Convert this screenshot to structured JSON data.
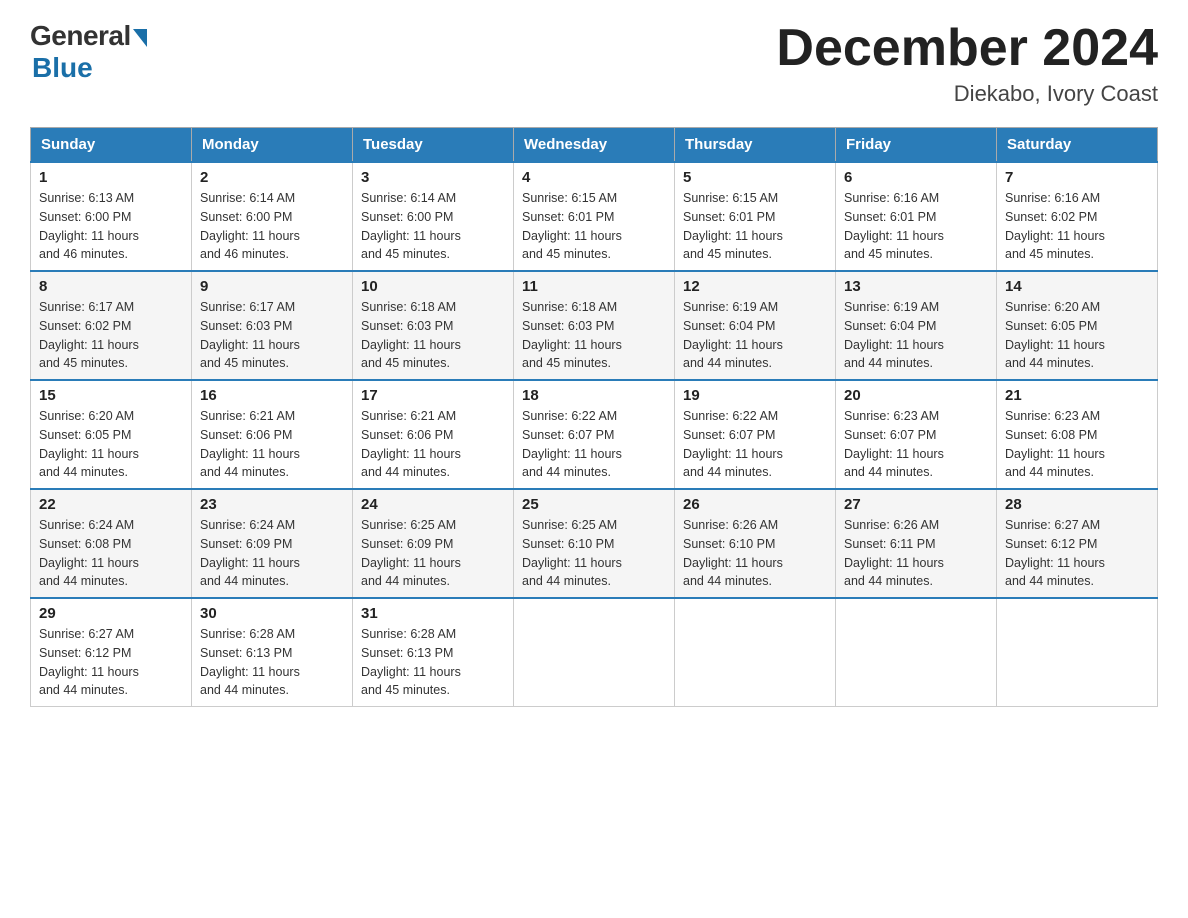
{
  "header": {
    "logo_general": "General",
    "logo_blue": "Blue",
    "month_title": "December 2024",
    "location": "Diekabo, Ivory Coast"
  },
  "weekdays": [
    "Sunday",
    "Monday",
    "Tuesday",
    "Wednesday",
    "Thursday",
    "Friday",
    "Saturday"
  ],
  "weeks": [
    [
      {
        "day": "1",
        "sunrise": "6:13 AM",
        "sunset": "6:00 PM",
        "daylight": "11 hours and 46 minutes."
      },
      {
        "day": "2",
        "sunrise": "6:14 AM",
        "sunset": "6:00 PM",
        "daylight": "11 hours and 46 minutes."
      },
      {
        "day": "3",
        "sunrise": "6:14 AM",
        "sunset": "6:00 PM",
        "daylight": "11 hours and 45 minutes."
      },
      {
        "day": "4",
        "sunrise": "6:15 AM",
        "sunset": "6:01 PM",
        "daylight": "11 hours and 45 minutes."
      },
      {
        "day": "5",
        "sunrise": "6:15 AM",
        "sunset": "6:01 PM",
        "daylight": "11 hours and 45 minutes."
      },
      {
        "day": "6",
        "sunrise": "6:16 AM",
        "sunset": "6:01 PM",
        "daylight": "11 hours and 45 minutes."
      },
      {
        "day": "7",
        "sunrise": "6:16 AM",
        "sunset": "6:02 PM",
        "daylight": "11 hours and 45 minutes."
      }
    ],
    [
      {
        "day": "8",
        "sunrise": "6:17 AM",
        "sunset": "6:02 PM",
        "daylight": "11 hours and 45 minutes."
      },
      {
        "day": "9",
        "sunrise": "6:17 AM",
        "sunset": "6:03 PM",
        "daylight": "11 hours and 45 minutes."
      },
      {
        "day": "10",
        "sunrise": "6:18 AM",
        "sunset": "6:03 PM",
        "daylight": "11 hours and 45 minutes."
      },
      {
        "day": "11",
        "sunrise": "6:18 AM",
        "sunset": "6:03 PM",
        "daylight": "11 hours and 45 minutes."
      },
      {
        "day": "12",
        "sunrise": "6:19 AM",
        "sunset": "6:04 PM",
        "daylight": "11 hours and 44 minutes."
      },
      {
        "day": "13",
        "sunrise": "6:19 AM",
        "sunset": "6:04 PM",
        "daylight": "11 hours and 44 minutes."
      },
      {
        "day": "14",
        "sunrise": "6:20 AM",
        "sunset": "6:05 PM",
        "daylight": "11 hours and 44 minutes."
      }
    ],
    [
      {
        "day": "15",
        "sunrise": "6:20 AM",
        "sunset": "6:05 PM",
        "daylight": "11 hours and 44 minutes."
      },
      {
        "day": "16",
        "sunrise": "6:21 AM",
        "sunset": "6:06 PM",
        "daylight": "11 hours and 44 minutes."
      },
      {
        "day": "17",
        "sunrise": "6:21 AM",
        "sunset": "6:06 PM",
        "daylight": "11 hours and 44 minutes."
      },
      {
        "day": "18",
        "sunrise": "6:22 AM",
        "sunset": "6:07 PM",
        "daylight": "11 hours and 44 minutes."
      },
      {
        "day": "19",
        "sunrise": "6:22 AM",
        "sunset": "6:07 PM",
        "daylight": "11 hours and 44 minutes."
      },
      {
        "day": "20",
        "sunrise": "6:23 AM",
        "sunset": "6:07 PM",
        "daylight": "11 hours and 44 minutes."
      },
      {
        "day": "21",
        "sunrise": "6:23 AM",
        "sunset": "6:08 PM",
        "daylight": "11 hours and 44 minutes."
      }
    ],
    [
      {
        "day": "22",
        "sunrise": "6:24 AM",
        "sunset": "6:08 PM",
        "daylight": "11 hours and 44 minutes."
      },
      {
        "day": "23",
        "sunrise": "6:24 AM",
        "sunset": "6:09 PM",
        "daylight": "11 hours and 44 minutes."
      },
      {
        "day": "24",
        "sunrise": "6:25 AM",
        "sunset": "6:09 PM",
        "daylight": "11 hours and 44 minutes."
      },
      {
        "day": "25",
        "sunrise": "6:25 AM",
        "sunset": "6:10 PM",
        "daylight": "11 hours and 44 minutes."
      },
      {
        "day": "26",
        "sunrise": "6:26 AM",
        "sunset": "6:10 PM",
        "daylight": "11 hours and 44 minutes."
      },
      {
        "day": "27",
        "sunrise": "6:26 AM",
        "sunset": "6:11 PM",
        "daylight": "11 hours and 44 minutes."
      },
      {
        "day": "28",
        "sunrise": "6:27 AM",
        "sunset": "6:12 PM",
        "daylight": "11 hours and 44 minutes."
      }
    ],
    [
      {
        "day": "29",
        "sunrise": "6:27 AM",
        "sunset": "6:12 PM",
        "daylight": "11 hours and 44 minutes."
      },
      {
        "day": "30",
        "sunrise": "6:28 AM",
        "sunset": "6:13 PM",
        "daylight": "11 hours and 44 minutes."
      },
      {
        "day": "31",
        "sunrise": "6:28 AM",
        "sunset": "6:13 PM",
        "daylight": "11 hours and 45 minutes."
      },
      null,
      null,
      null,
      null
    ]
  ],
  "labels": {
    "sunrise": "Sunrise:",
    "sunset": "Sunset:",
    "daylight": "Daylight:"
  }
}
